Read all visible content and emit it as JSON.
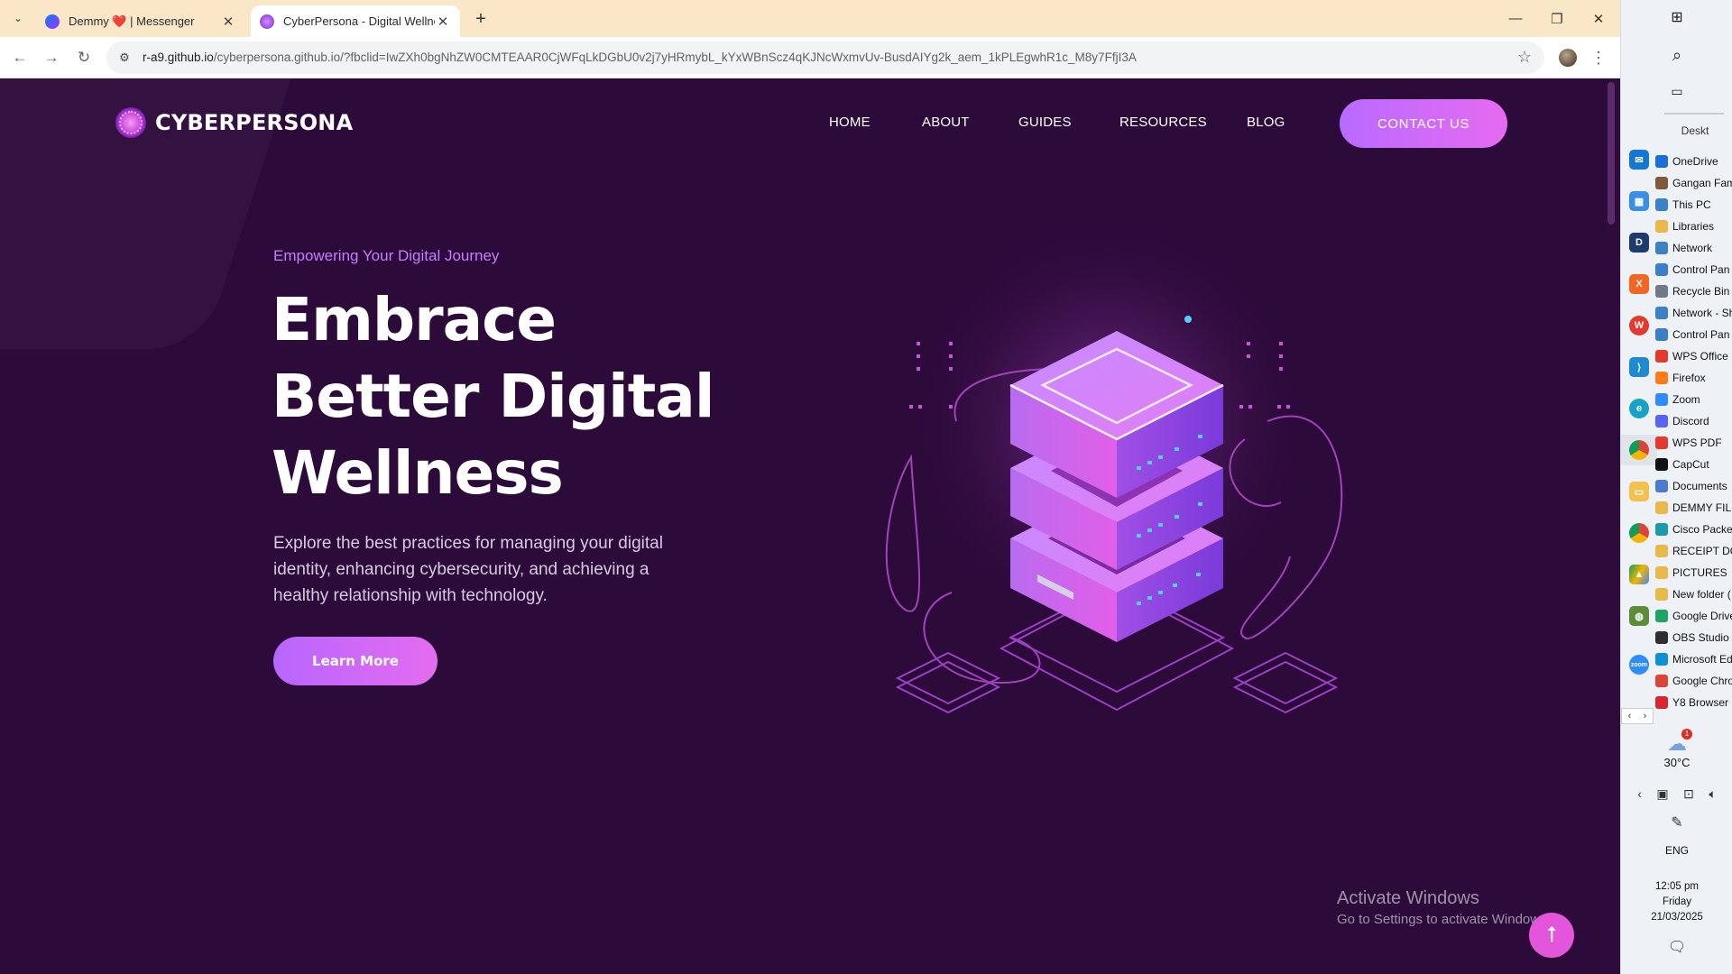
{
  "browser": {
    "tabs": [
      {
        "title": "Demmy ❤️ | Messenger",
        "active": false
      },
      {
        "title": "CyberPersona - Digital Wellness",
        "active": true
      }
    ],
    "url_host": "r-a9.github.io",
    "url_rest": "/cyberpersona.github.io/?fbclid=IwZXh0bgNhZW0CMTEAAR0CjWFqLkDGbU0v2j7yHRmybL_kYxWBnScz4qKJNcWxmvUv-BusdAIYg2k_aem_1kPLEgwhR1c_M8y7FfjI3A",
    "window_controls": [
      "—",
      "❐",
      "✕"
    ]
  },
  "site": {
    "logo_text": "CYBERPERSONA",
    "nav": [
      "HOME",
      "ABOUT",
      "GUIDES",
      "RESOURCES",
      "BLOG"
    ],
    "contact_label": "CONTACT US",
    "tagline": "Empowering Your Digital Journey",
    "hero_lines": [
      "Embrace",
      "Better Digital",
      "Wellness"
    ],
    "description": "Explore the best practices for managing your digital identity, enhancing cybersecurity, and achieving a healthy relationship with technology.",
    "cta_label": "Learn More",
    "accent": "#c77dff",
    "button_gradient": [
      "#b866ff",
      "#e46cf0"
    ],
    "background": "#2c0a3a"
  },
  "watermark": {
    "title": "Activate Windows",
    "subtitle": "Go to Settings to activate Windows."
  },
  "taskbar": {
    "desktop_title": "Deskt",
    "desktop_items": [
      {
        "label": "OneDrive",
        "color": "#1b6fd6"
      },
      {
        "label": "Gangan Fam",
        "color": "#7c5a3a"
      },
      {
        "label": "This PC",
        "color": "#3b82c4"
      },
      {
        "label": "Libraries",
        "color": "#e8b84a"
      },
      {
        "label": "Network",
        "color": "#3b82c4"
      },
      {
        "label": "Control Pan",
        "color": "#3b7fc9"
      },
      {
        "label": "Recycle Bin",
        "color": "#6f7a86"
      },
      {
        "label": "Network - Sh",
        "color": "#3b82c4"
      },
      {
        "label": "Control Pan",
        "color": "#3b7fc9"
      },
      {
        "label": "WPS Office",
        "color": "#e23b2e"
      },
      {
        "label": "Firefox",
        "color": "#ff7a1a"
      },
      {
        "label": "Zoom",
        "color": "#2d8cff"
      },
      {
        "label": "Discord",
        "color": "#5865f2"
      },
      {
        "label": "WPS PDF",
        "color": "#e23b2e"
      },
      {
        "label": "CapCut",
        "color": "#111111"
      },
      {
        "label": "Documents",
        "color": "#4b7bd1"
      },
      {
        "label": "DEMMY FILE",
        "color": "#e8b84a"
      },
      {
        "label": "Cisco Packet",
        "color": "#1d9aa7"
      },
      {
        "label": "RECEIPT DO",
        "color": "#e8b84a"
      },
      {
        "label": "PICTURES",
        "color": "#e8b84a"
      },
      {
        "label": "New folder (",
        "color": "#e8b84a"
      },
      {
        "label": "Google Drive",
        "color": "#1fa463"
      },
      {
        "label": "OBS Studio",
        "color": "#302e31"
      },
      {
        "label": "Microsoft Ed",
        "color": "#0f8fd6"
      },
      {
        "label": "Google Chro",
        "color": "#db4437"
      },
      {
        "label": "Y8 Browser",
        "color": "#d6262f"
      }
    ],
    "weather_temp": "30°C",
    "weather_badge": "1",
    "language": "ENG",
    "time": "12:05 pm",
    "day": "Friday",
    "date": "21/03/2025"
  }
}
